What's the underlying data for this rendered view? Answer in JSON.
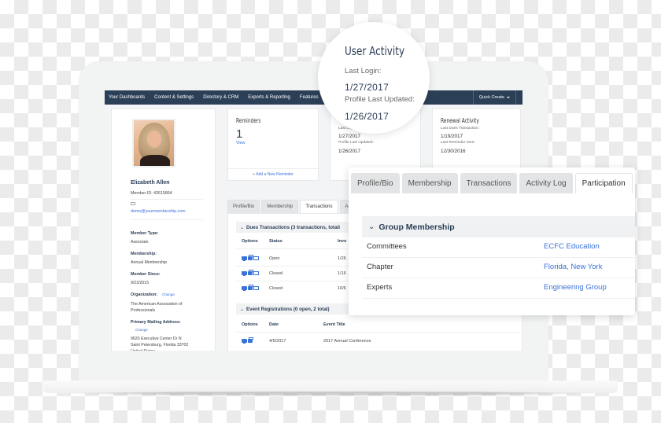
{
  "nav": {
    "items": [
      "Your Dashboards",
      "Content & Settings",
      "Directory & CRM",
      "Exports & Reporting",
      "Features"
    ],
    "quick_create": "Quick Create"
  },
  "profile": {
    "name": "Elizabeth Allen",
    "member_id": "Member ID: 42615864",
    "email": "demo@yourmembership.com",
    "fields": [
      {
        "label": "Member Type:",
        "value": "Associate"
      },
      {
        "label": "Membership:",
        "value": "Annual Membership"
      },
      {
        "label": "Member Since:",
        "value": "9/23/2015"
      }
    ],
    "organization_label": "Organization:",
    "organization_change": "Change",
    "organization_value_1": "The American Association of",
    "organization_value_2": "Professionals",
    "address_label": "Primary Mailing Address:",
    "address_change": "Change",
    "address_line_1": "9620 Executive Center Dr N",
    "address_line_2": "Saint Petersburg, Florida  33702",
    "address_line_3": "United States"
  },
  "reminders": {
    "title": "Reminders",
    "count": "1",
    "view": "View",
    "add": "+ Add a New Reminder"
  },
  "activity_panel": {
    "label_1": "Last Login:",
    "date_1": "1/27/2017",
    "label_2": "Profile Last Updated:",
    "date_2": "1/26/2017"
  },
  "renewal": {
    "title": "Renewal Activity",
    "label_1": "Last Dues Transaction:",
    "date_1": "1/19/2017",
    "label_2": "Last Reminder Sent:",
    "date_2": "12/30/2016"
  },
  "small_tabs": [
    "Profile/Bio",
    "Membership",
    "Transactions",
    "Ac"
  ],
  "small_tabs_active": "Transactions",
  "dues": {
    "header": "Dues Transactions  (3 transactions, totali",
    "columns": [
      "Options",
      "Status",
      "Invo"
    ],
    "rows": [
      {
        "status": "Open",
        "date": "1/26"
      },
      {
        "status": "Closed",
        "date": "1/16"
      },
      {
        "status": "Closed",
        "date": "10/6"
      }
    ]
  },
  "events": {
    "header": "Event Registrations  (0 open, 2 total)",
    "columns": [
      "Options",
      "Date",
      "Event Title"
    ],
    "rows": [
      {
        "date": "4/5/2017",
        "title": "2017 Annual Conference"
      }
    ]
  },
  "user_activity": {
    "title": "User Activity",
    "last_login_label": "Last Login:",
    "last_login": "1/27/2017",
    "profile_updated_label": "Profile Last Updated:",
    "profile_updated": "1/26/2017"
  },
  "participation": {
    "tabs": [
      "Profile/Bio",
      "Membership",
      "Transactions",
      "Activity Log",
      "Participation"
    ],
    "active_tab": "Participation",
    "section": "Group Membership",
    "rows": [
      {
        "key": "Committees",
        "value": "ECFC Education"
      },
      {
        "key": "Chapter",
        "value": "Florida, New York"
      },
      {
        "key": "Experts",
        "value": "Engineering Group"
      }
    ]
  },
  "colors": {
    "nav": "#2b3f57",
    "link": "#3a73d8"
  }
}
